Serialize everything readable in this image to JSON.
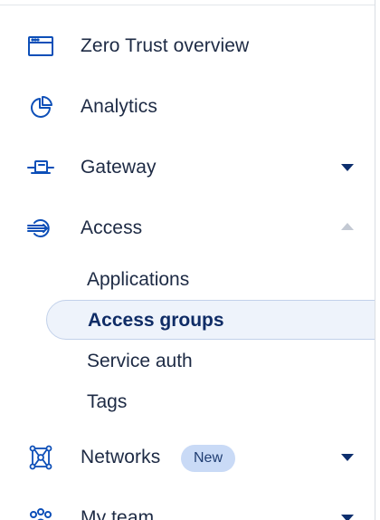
{
  "sidebar": {
    "items": [
      {
        "label": "Zero Trust overview",
        "icon": "browser-window-icon"
      },
      {
        "label": "Analytics",
        "icon": "pie-chart-icon"
      },
      {
        "label": "Gateway",
        "icon": "gateway-icon"
      },
      {
        "label": "Access",
        "icon": "access-arrow-icon"
      },
      {
        "label": "Networks",
        "icon": "network-nodes-icon",
        "badge": "New"
      },
      {
        "label": "My team",
        "icon": "team-icon"
      }
    ],
    "access_subitems": [
      {
        "label": "Applications"
      },
      {
        "label": "Access groups",
        "active": true
      },
      {
        "label": "Service auth"
      },
      {
        "label": "Tags"
      }
    ]
  },
  "colors": {
    "icon": "#0d4fb8",
    "text": "#1d2a44",
    "active_bg": "#eef3fb",
    "badge_bg": "#c9daf6"
  }
}
